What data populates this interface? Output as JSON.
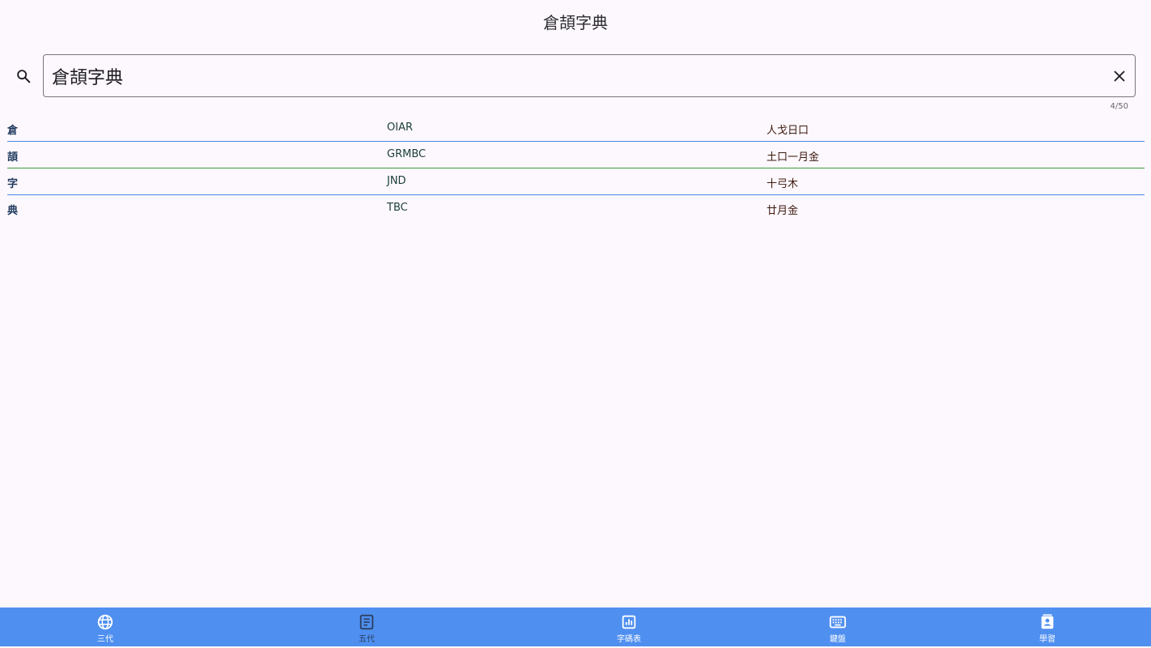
{
  "app": {
    "title": "倉頡字典"
  },
  "search": {
    "value": "倉頡字典",
    "counter": "4/50"
  },
  "results": [
    {
      "char": "倉",
      "code": "OIAR",
      "radicals": "人戈日口"
    },
    {
      "char": "頡",
      "code": "GRMBC",
      "radicals": "土口一月金"
    },
    {
      "char": "字",
      "code": "JND",
      "radicals": "十弓木"
    },
    {
      "char": "典",
      "code": "TBC",
      "radicals": "廿月金"
    }
  ],
  "nav": {
    "items": [
      {
        "label": "三代",
        "icon": "globe-icon"
      },
      {
        "label": "五代",
        "icon": "article-icon"
      },
      {
        "label": "字碼表",
        "icon": "chart-icon"
      },
      {
        "label": "鍵盤",
        "icon": "keyboard-icon"
      },
      {
        "label": "學習",
        "icon": "contact-card-icon"
      }
    ]
  },
  "colors": {
    "background": "#fdf8fd",
    "nav_background": "#4f8ff0",
    "divider_blue": "#4a86e8",
    "divider_green": "#3a9a3a"
  }
}
